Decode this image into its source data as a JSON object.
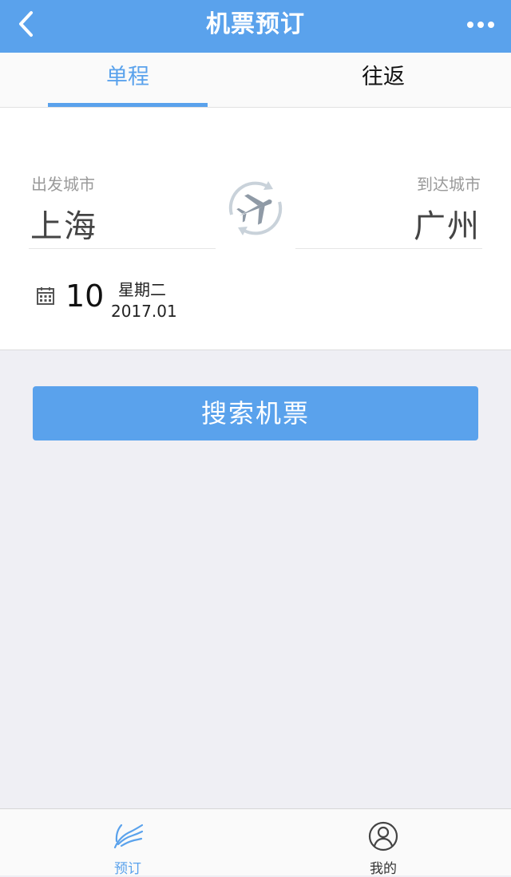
{
  "header": {
    "title": "机票预订",
    "back_icon": "chevron-left-icon",
    "more_icon": "more-dots-icon"
  },
  "tabs": [
    {
      "label": "单程",
      "active": true
    },
    {
      "label": "往返",
      "active": false
    }
  ],
  "route": {
    "from_label": "出发城市",
    "from_city": "上海",
    "to_label": "到达城市",
    "to_city": "广州",
    "swap_icon": "plane-swap-icon"
  },
  "date": {
    "icon": "calendar-icon",
    "day": "10",
    "weekday": "星期二",
    "year_month": "2017.01"
  },
  "search_button": {
    "label": "搜索机票"
  },
  "bottom_nav": [
    {
      "label": "预订",
      "icon": "swallow-bird-icon",
      "active": true
    },
    {
      "label": "我的",
      "icon": "user-circle-icon",
      "active": false
    }
  ],
  "colors": {
    "accent": "#5aa2ec",
    "background": "#efeff4"
  }
}
